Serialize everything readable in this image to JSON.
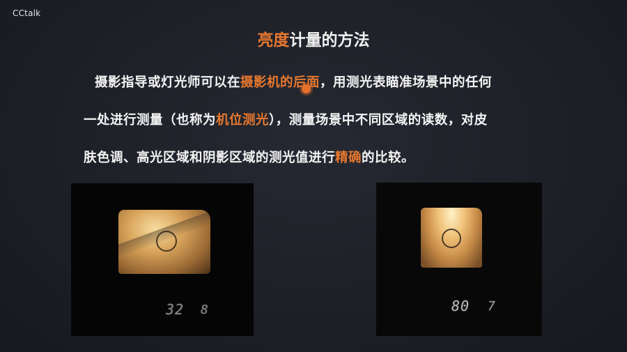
{
  "app": {
    "brand": "CCtalk"
  },
  "slide": {
    "title_accent": "亮度",
    "title_rest": "计量的方法",
    "line1": {
      "a": "摄影指导或灯光师可以在",
      "b_accent": "摄影机的后面",
      "c": "，用测光表瞄准场景中的任何"
    },
    "line2": {
      "a": "一处进行测量（也称为",
      "b_accent": "机位测光",
      "c": "），测量场景中不同区域的读数，对皮"
    },
    "line3": {
      "a": "肤色调、高光区域和阴影区域的测光值进行",
      "b_accent": "精确",
      "c": "的比较。"
    }
  },
  "photos": {
    "left": {
      "lcd_main": "32",
      "lcd_sub": "8"
    },
    "right": {
      "lcd_main": "80",
      "lcd_sub": "7"
    }
  },
  "colors": {
    "background": "#1e2026",
    "accent": "#e7782f",
    "text": "#f4f4f4"
  }
}
